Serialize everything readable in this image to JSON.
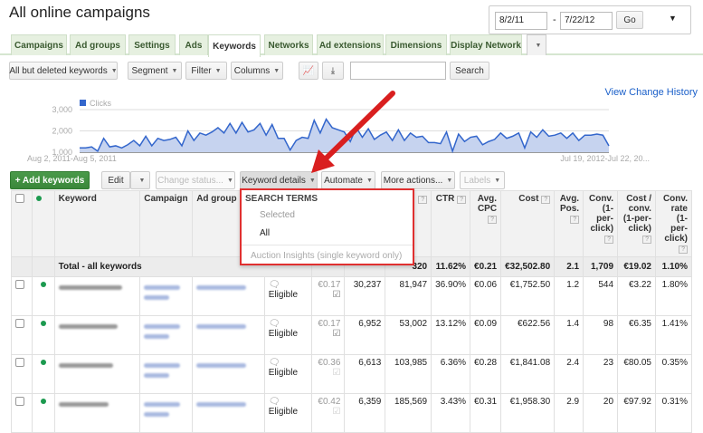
{
  "page_title": "All online campaigns",
  "date_range": {
    "start": "8/2/11",
    "separator": "-",
    "end": "7/22/12",
    "go": "Go"
  },
  "tabs": [
    "Campaigns",
    "Ad groups",
    "Settings",
    "Ads",
    "Keywords",
    "Networks",
    "Ad extensions",
    "Dimensions",
    "Display Network"
  ],
  "active_tab": "Keywords",
  "toolbar": {
    "filter_select": "All but deleted keywords",
    "segment": "Segment",
    "filter": "Filter",
    "columns": "Columns",
    "search_value": "",
    "search": "Search"
  },
  "view_change_history": "View Change History",
  "chart_data": {
    "type": "area",
    "series": [
      {
        "name": "Clicks",
        "color": "#3366cc",
        "values": [
          1200,
          1200,
          1250,
          1050,
          1650,
          1250,
          1300,
          1200,
          1350,
          1550,
          1300,
          1750,
          1300,
          1650,
          1550,
          1600,
          1700,
          1300,
          2000,
          1550,
          1900,
          1800,
          1950,
          2150,
          1900,
          2350,
          1900,
          2400,
          1950,
          2050,
          2350,
          1800,
          2300,
          1650,
          1650,
          1100,
          1550,
          1700,
          1650,
          2500,
          1900,
          2550,
          2150,
          2050,
          1950,
          1500,
          2150,
          1700,
          2100,
          1600,
          1800,
          1950,
          1550,
          2050,
          1550,
          1900,
          1700,
          1750,
          1450,
          1450,
          1400,
          1950,
          1050,
          1850,
          1500,
          1700,
          1750,
          1350,
          1500,
          1600,
          1900,
          1650,
          1750,
          1900,
          1200,
          1950,
          1700,
          2050,
          1750,
          1800,
          1900,
          1650,
          1900,
          1550,
          1800,
          1800,
          1850,
          1800,
          1300
        ]
      }
    ],
    "yticks": [
      "3,000",
      "2,000",
      "1,000"
    ],
    "ylim": [
      1000,
      3000
    ],
    "xlabels": [
      "Aug 2, 2011-Aug 5, 2011",
      "Jul 19, 2012-Jul 22, 20..."
    ],
    "legend": "Clicks",
    "legend_position": "top-left"
  },
  "actions": {
    "add": "+ Add keywords",
    "edit": "Edit",
    "change_status": "Change status...",
    "keyword_details": "Keyword details",
    "automate": "Automate",
    "more_actions": "More actions...",
    "labels": "Labels"
  },
  "dropdown": {
    "header": "SEARCH TERMS",
    "items": [
      "Selected",
      "All"
    ],
    "footer": "Auction Insights (single keyword only)"
  },
  "columns": [
    "Keyword",
    "Campaign",
    "Ad group",
    "CTR",
    "Avg. CPC",
    "Cost",
    "Avg. Pos.",
    "Conv. (1-per-click)",
    "Cost / conv. (1-per-click)",
    "Conv. rate (1-per-click)"
  ],
  "help": "?",
  "total": {
    "label": "Total - all keywords",
    "impr": "320",
    "ctr": "11.62%",
    "avg_cpc": "€0.21",
    "cost": "€32,502.80",
    "avg_pos": "2.1",
    "conv": "1,709",
    "cost_conv": "€19.02",
    "conv_rate": "1.10%"
  },
  "rows": [
    {
      "status": "Eligible",
      "max_cpc": "€0.17",
      "clicks": "30,237",
      "impr": "81,947",
      "ctr": "36.90%",
      "avg_cpc": "€0.06",
      "cost": "€1,752.50",
      "avg_pos": "1.2",
      "conv": "544",
      "cost_conv": "€3.22",
      "conv_rate": "1.80%"
    },
    {
      "status": "Eligible",
      "max_cpc": "€0.17",
      "clicks": "6,952",
      "impr": "53,002",
      "ctr": "13.12%",
      "avg_cpc": "€0.09",
      "cost": "€622.56",
      "avg_pos": "1.4",
      "conv": "98",
      "cost_conv": "€6.35",
      "conv_rate": "1.41%"
    },
    {
      "status": "Eligible",
      "max_cpc": "€0.36",
      "clicks": "6,613",
      "impr": "103,985",
      "ctr": "6.36%",
      "avg_cpc": "€0.28",
      "cost": "€1,841.08",
      "avg_pos": "2.4",
      "conv": "23",
      "cost_conv": "€80.05",
      "conv_rate": "0.35%"
    },
    {
      "status": "Eligible",
      "max_cpc": "€0.42",
      "clicks": "6,359",
      "impr": "185,569",
      "ctr": "3.43%",
      "avg_cpc": "€0.31",
      "cost": "€1,958.30",
      "avg_pos": "2.9",
      "conv": "20",
      "cost_conv": "€97.92",
      "conv_rate": "0.31%"
    }
  ]
}
